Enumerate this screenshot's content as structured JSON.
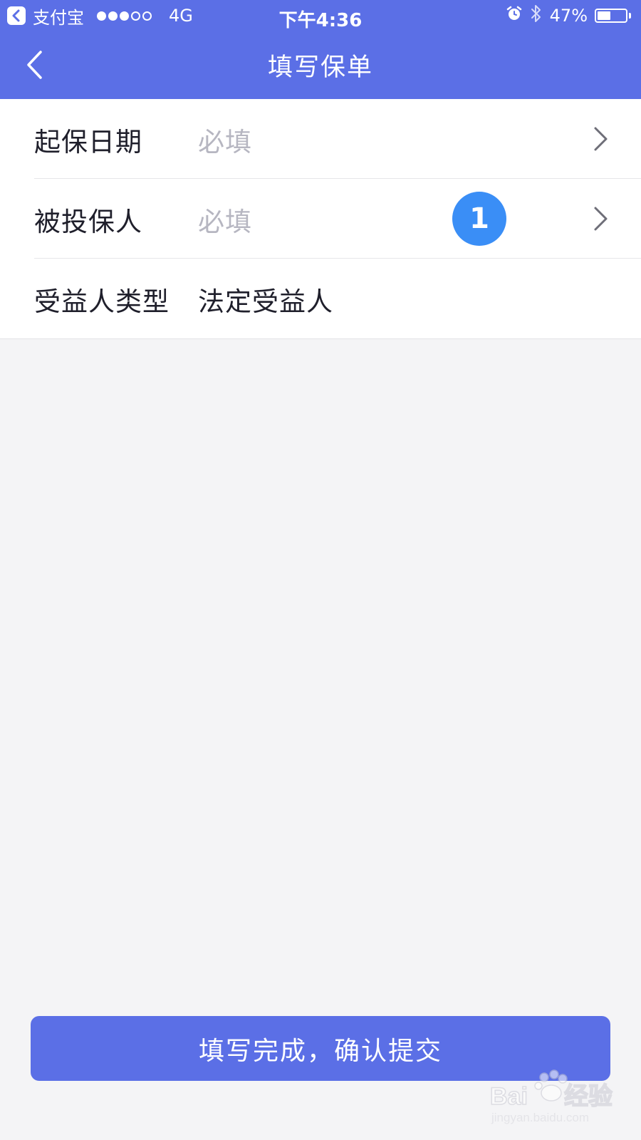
{
  "status_bar": {
    "app_name": "支付宝",
    "network": "4G",
    "time": "下午4:36",
    "battery_percent": "47%",
    "battery_level": 0.47,
    "signal_bars_on": 3,
    "signal_bars_total": 5
  },
  "header": {
    "title": "填写保单"
  },
  "form": {
    "rows": [
      {
        "label": "起保日期",
        "value": "必填",
        "has_chevron": true
      },
      {
        "label": "被投保人",
        "value": "必填",
        "has_chevron": true,
        "badge": "1"
      },
      {
        "label": "受益人类型",
        "value": "法定受益人",
        "has_chevron": false
      }
    ]
  },
  "submit": {
    "label": "填写完成，确认提交"
  },
  "colors": {
    "brand": "#5b6fe6",
    "badge": "#3a8ef6",
    "placeholder": "#b6b6c1",
    "text": "#1f1f2b",
    "background": "#f4f4f6"
  },
  "icons": {
    "back": "chevron-left-icon",
    "row_chevron": "chevron-right-icon",
    "alarm": "alarm-icon",
    "bluetooth": "bluetooth-icon",
    "battery": "battery-icon",
    "app_back": "app-back-icon"
  }
}
